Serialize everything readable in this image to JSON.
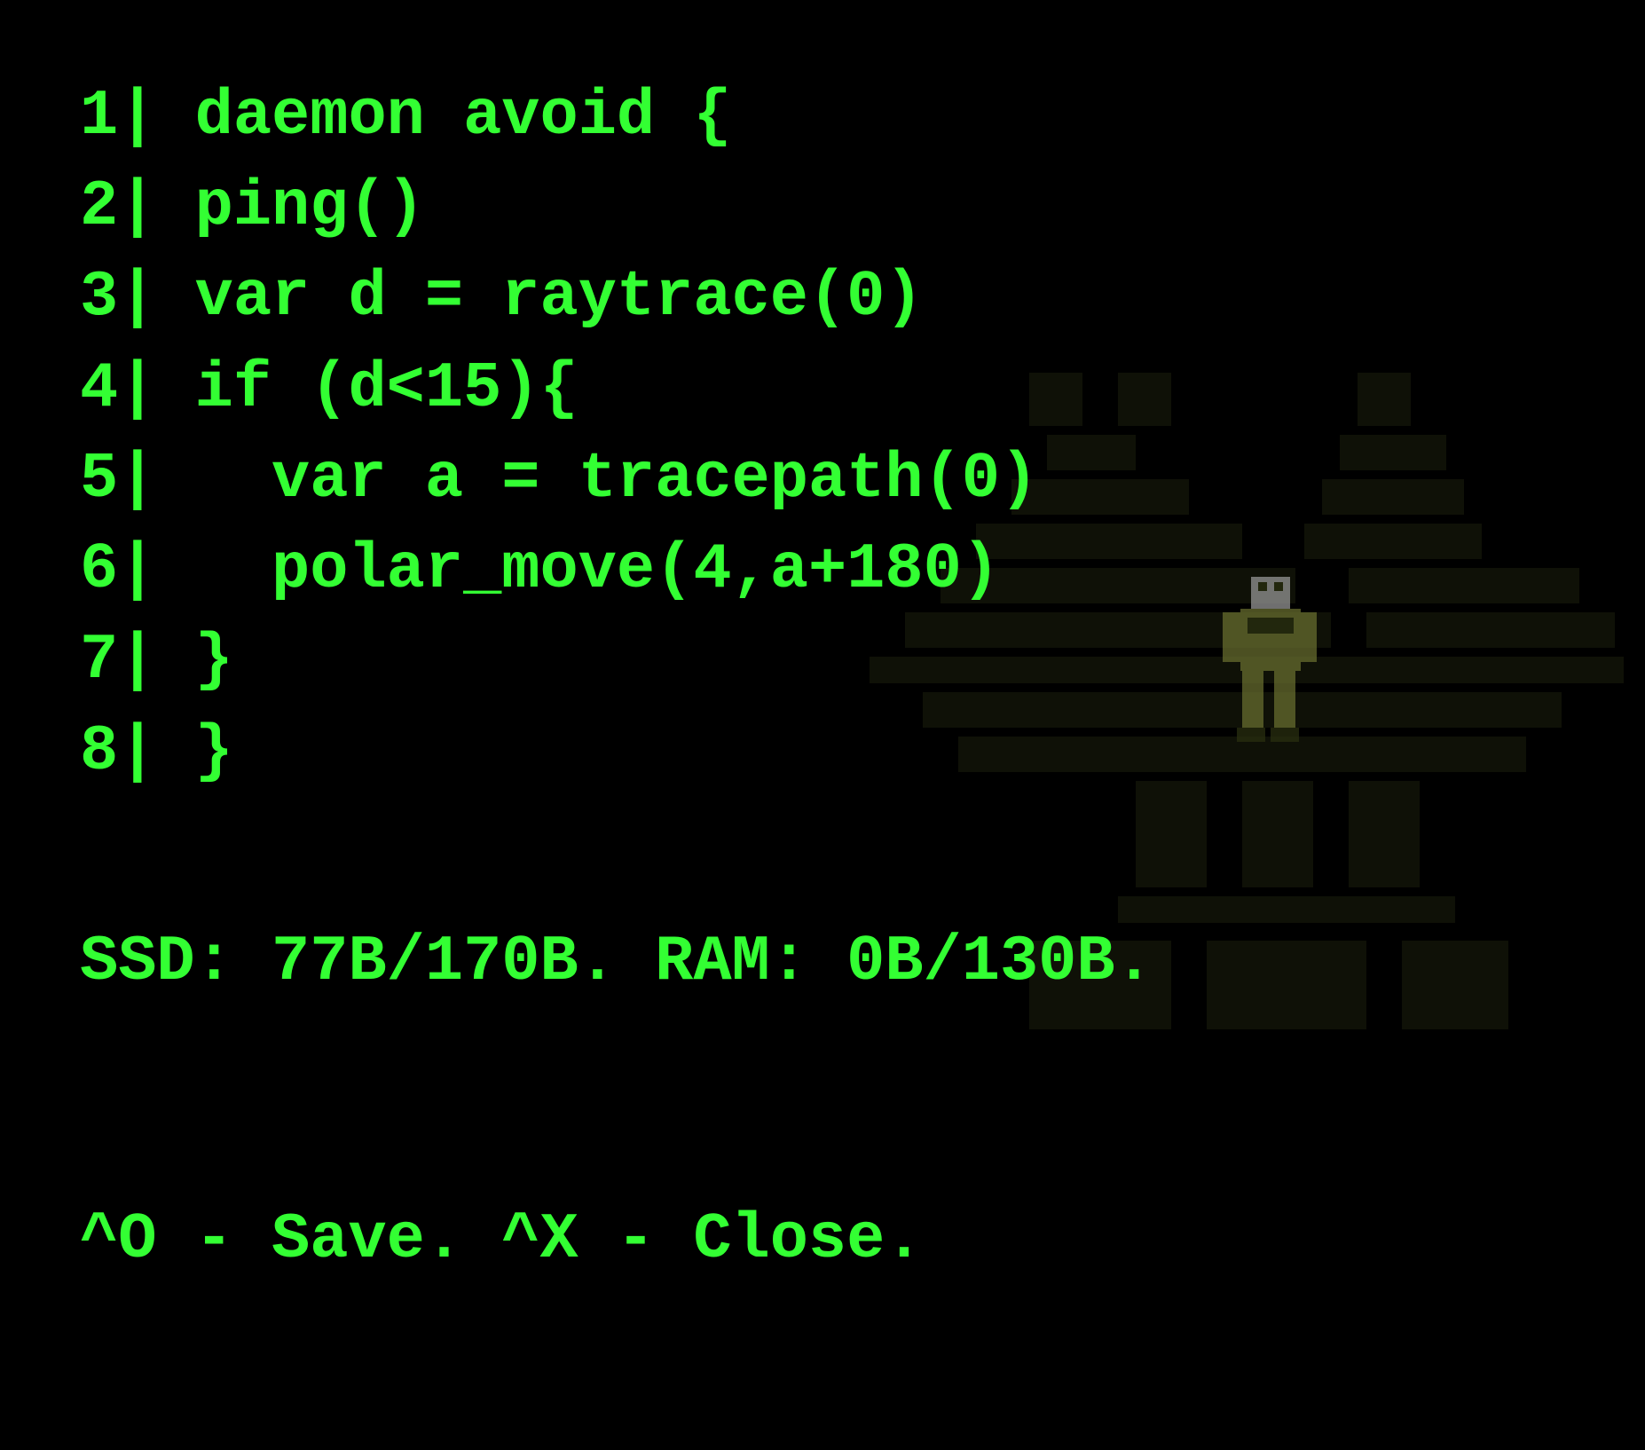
{
  "editor": {
    "lines": [
      {
        "num": "1",
        "code": "daemon avoid {"
      },
      {
        "num": "2",
        "code": "ping()"
      },
      {
        "num": "3",
        "code": "var d = raytrace(0)"
      },
      {
        "num": "4",
        "code": "if (d<15){"
      },
      {
        "num": "5",
        "code": "  var a = tracepath(0)"
      },
      {
        "num": "6",
        "code": "  polar_move(4,a+180)"
      },
      {
        "num": "7",
        "code": "}"
      },
      {
        "num": "8",
        "code": "}"
      }
    ]
  },
  "status": {
    "memory_line": "SSD: 77B/170B. RAM: 0B/130B.",
    "shortcuts_line": "^O - Save. ^X - Close."
  },
  "colors": {
    "foreground": "#33ff33",
    "background": "#000000"
  }
}
